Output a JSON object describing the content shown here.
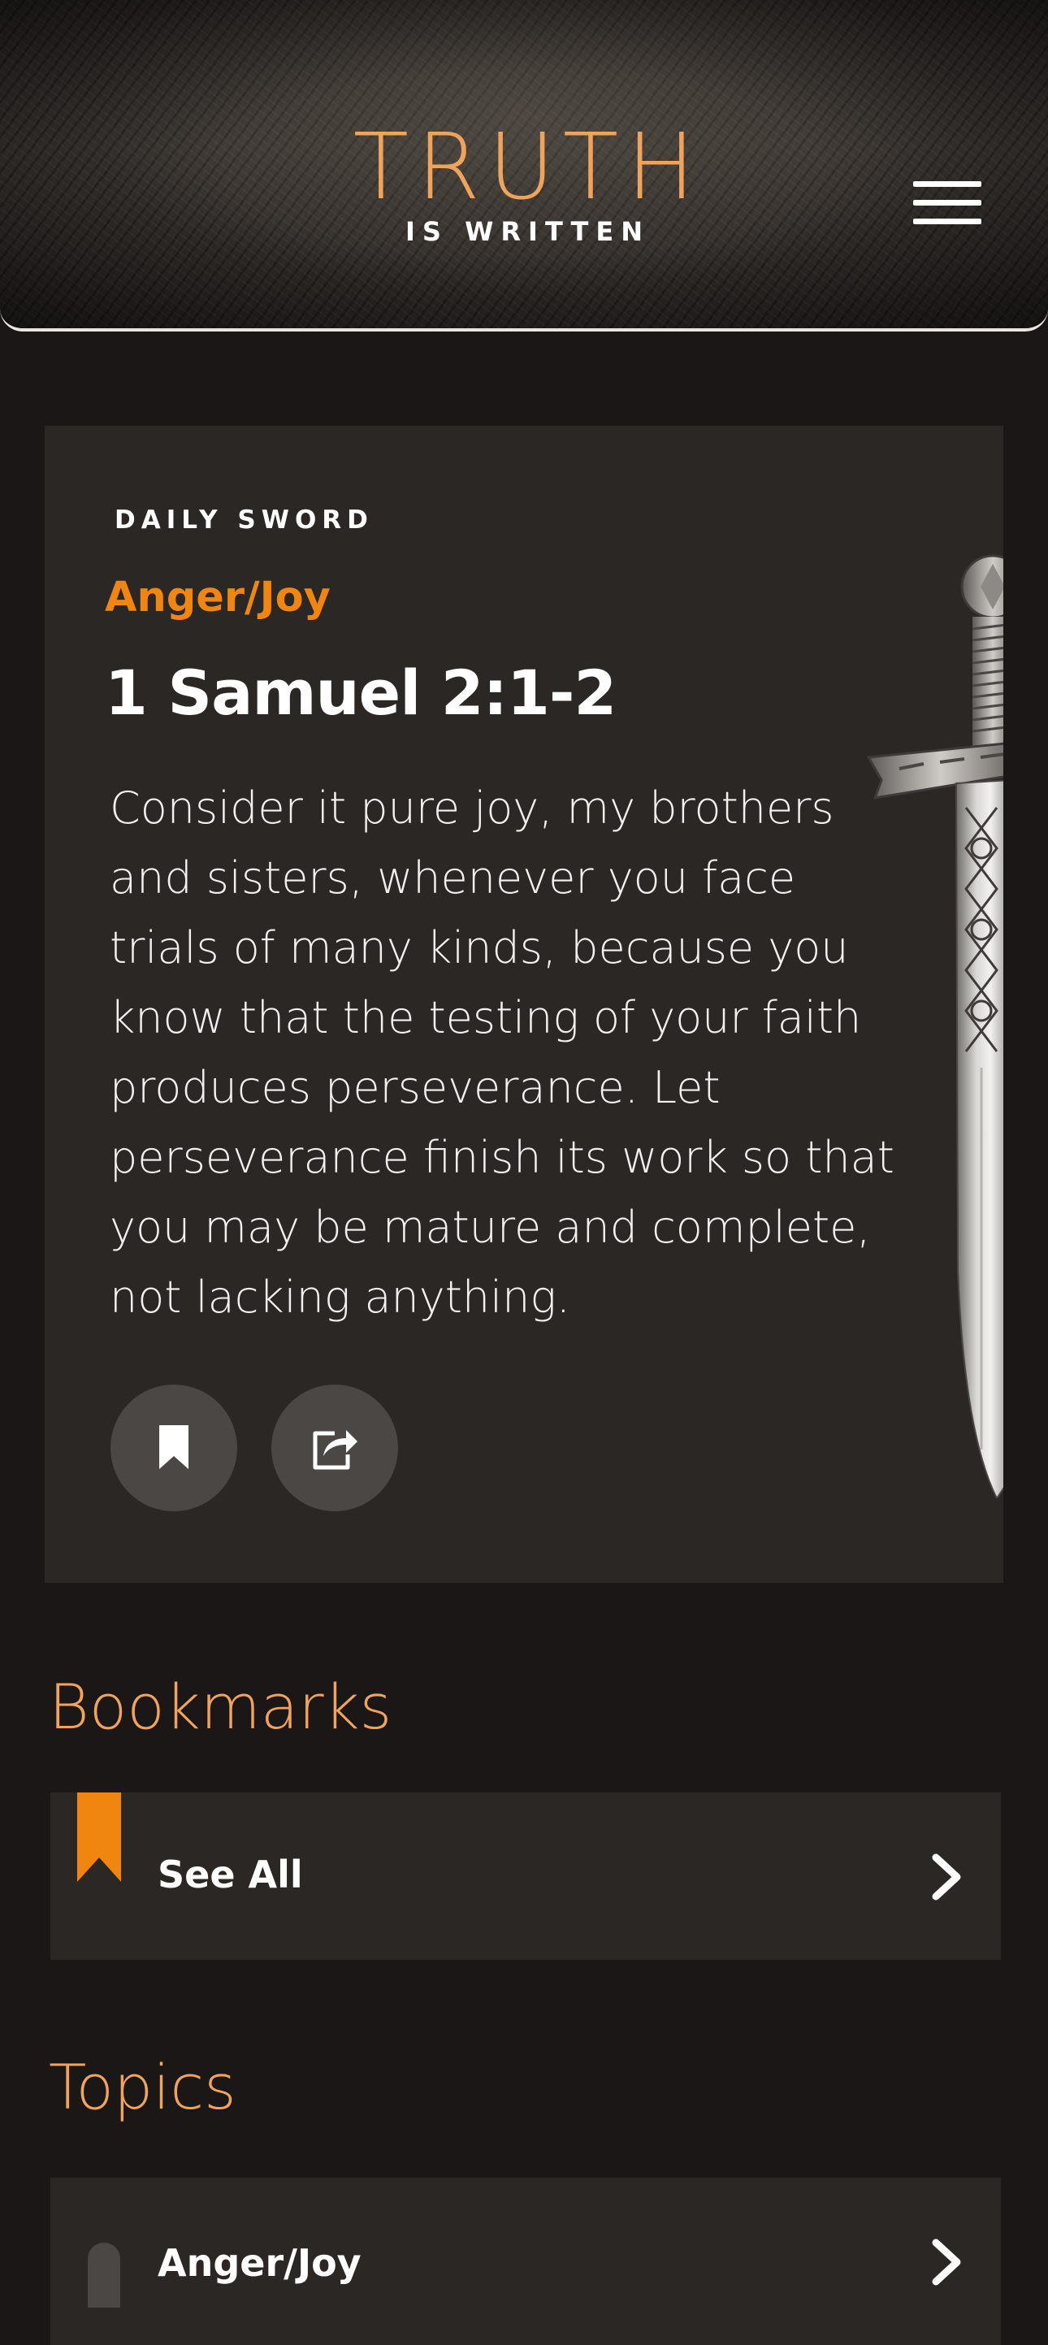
{
  "header": {
    "brand_title": "TRUTH",
    "brand_subtitle": "IS WRITTEN",
    "menu_icon": "hamburger-menu-icon"
  },
  "daily": {
    "eyebrow": "DAILY SWORD",
    "topic": "Anger/Joy",
    "reference": "1 Samuel 2:1-2",
    "verse": "Consider it pure joy, my brothers and sisters, whenever you face trials of many kinds, because you know that the testing of your faith produces perseverance. Let perseverance finish its work so that you may be mature and complete, not lacking anything.",
    "actions": [
      {
        "name": "bookmark",
        "icon": "bookmark-icon"
      },
      {
        "name": "share",
        "icon": "share-icon"
      }
    ],
    "illustration": "sword"
  },
  "bookmarks": {
    "title": "Bookmarks",
    "see_all_label": "See All",
    "icon": "bookmark-ribbon-icon"
  },
  "topics": {
    "title": "Topics",
    "items": [
      {
        "label": "Anger/Joy"
      }
    ]
  },
  "colors": {
    "background": "#1b1716",
    "card": "#2b2725",
    "accent": "#f0850f",
    "accent_light": "#f0a35a",
    "button": "#4b4745",
    "text": "#ffffff"
  }
}
